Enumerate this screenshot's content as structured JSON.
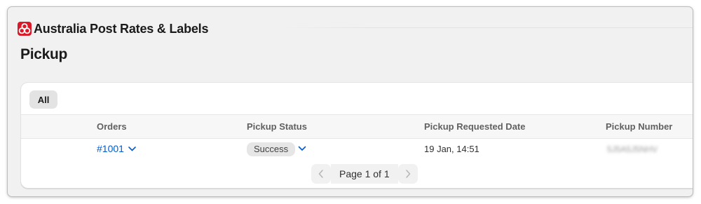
{
  "app": {
    "title": "Australia Post Rates & Labels",
    "logo_icon": "auspost-logo-icon",
    "brand_color": "#dc1928"
  },
  "page": {
    "title": "Pickup"
  },
  "tabs": [
    {
      "label": "All",
      "selected": true
    }
  ],
  "table": {
    "columns": [
      "Orders",
      "Pickup Status",
      "Pickup Requested Date",
      "Pickup Number"
    ],
    "rows": [
      {
        "order": "#1001",
        "status": "Success",
        "requested_date": "19 Jan, 14:51",
        "pickup_number": "5J5A5J5NHV"
      }
    ]
  },
  "pagination": {
    "label": "Page 1 of 1",
    "prev_icon": "chevron-left-icon",
    "next_icon": "chevron-right-icon"
  },
  "colors": {
    "link": "#005bd3",
    "background": "#f1f1f1"
  }
}
